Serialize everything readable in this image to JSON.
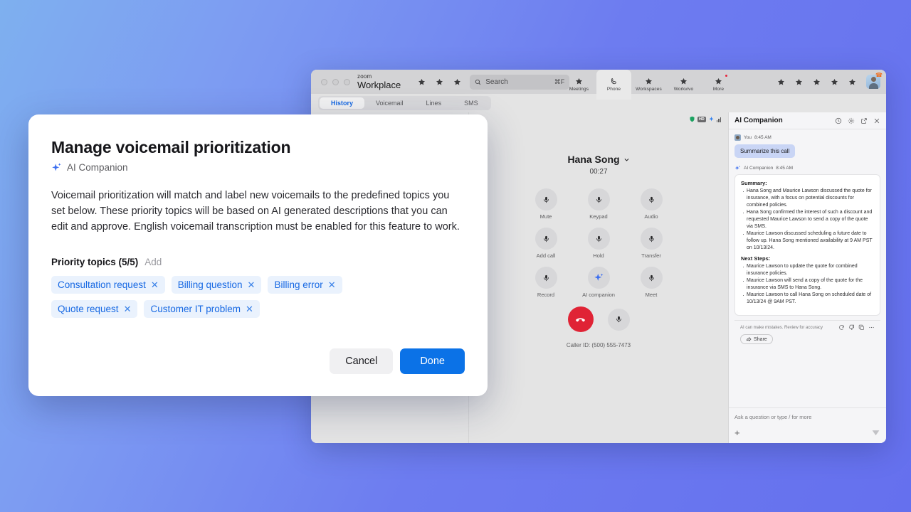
{
  "app": {
    "brand_top": "zoom",
    "brand_bottom": "Workplace",
    "search": {
      "placeholder": "Search",
      "shortcut": "⌘F"
    },
    "nav_tabs": [
      {
        "label": "Meetings",
        "icon": "star-icon",
        "active": false,
        "badge": false
      },
      {
        "label": "Phone",
        "icon": "phone-icon",
        "active": true,
        "badge": false
      },
      {
        "label": "Workspaces",
        "icon": "star-icon",
        "active": false,
        "badge": false
      },
      {
        "label": "Workvivo",
        "icon": "star-icon",
        "active": false,
        "badge": false
      },
      {
        "label": "More",
        "icon": "star-icon",
        "active": false,
        "badge": true
      }
    ],
    "sub_tabs": [
      {
        "label": "History",
        "active": true
      },
      {
        "label": "Voicemail",
        "active": false
      },
      {
        "label": "Lines",
        "active": false
      },
      {
        "label": "SMS",
        "active": false
      }
    ],
    "status_icons": [
      "shield-icon",
      "hd-badge",
      "sparkle-icon",
      "signal-bars-icon"
    ],
    "hd_label": "HD"
  },
  "call": {
    "caller_name": "Hana Song",
    "timer": "00:27",
    "caller_id": "Caller ID: (500) 555-7473",
    "controls": [
      {
        "label": "Mute",
        "icon": "microphone-icon"
      },
      {
        "label": "Keypad",
        "icon": "microphone-icon"
      },
      {
        "label": "Audio",
        "icon": "microphone-icon"
      },
      {
        "label": "Add call",
        "icon": "microphone-icon"
      },
      {
        "label": "Hold",
        "icon": "microphone-icon"
      },
      {
        "label": "Transfer",
        "icon": "microphone-icon"
      },
      {
        "label": "Record",
        "icon": "microphone-icon"
      },
      {
        "label": "AI companion",
        "icon": "sparkle-icon"
      },
      {
        "label": "Meet",
        "icon": "microphone-icon"
      }
    ]
  },
  "ai_panel": {
    "title": "AI Companion",
    "header_icons": [
      "history-icon",
      "gear-icon",
      "popout-icon",
      "close-icon"
    ],
    "user_message": {
      "author": "You",
      "time": "8:45 AM",
      "text": "Summarize this call"
    },
    "assistant_message": {
      "author": "AI Companion",
      "time": "8:45 AM",
      "summary_title": "Summary:",
      "summary_items": [
        "Hana Song and Maurice Lawson discussed the quote for insurance, with a focus on potential discounts for combined policies.",
        "Hana Song confirmed the interest of such a discount and requested Maurice Lawson to send a copy of the quote via SMS.",
        "Maurice Lawson discussed scheduling a future date to follow up. Hana Song mentioned availability at 9 AM PST on 10/13/24."
      ],
      "next_steps_title": "Next Steps:",
      "next_steps_items": [
        "Maurice Lawson to update the quote for combined insurance policies.",
        "Maurice Lawson will send a copy of the quote for the insurance via SMS to Hana Song.",
        "Maurice Lawson to call Hana Song on scheduled date of 10/13/24 @ 9AM PST."
      ]
    },
    "disclaimer": "AI can make mistakes. Review for accuracy",
    "footer_icons": [
      "regenerate-icon",
      "thumbs-down-icon",
      "copy-icon",
      "more-icon"
    ],
    "share_label": "Share",
    "input_placeholder": "Ask a question or type / for more"
  },
  "modal": {
    "title": "Manage voicemail prioritization",
    "subtitle": "AI Companion",
    "description": "Voicemail prioritization will match and label new voicemails to the predefined topics you set below. These priority topics will be based on AI generated descriptions that you can edit and approve. English voicemail transcription must be enabled for this feature to work.",
    "topics_label": "Priority topics (5/5)",
    "add_label": "Add",
    "topics": [
      "Consultation request",
      "Billing question",
      "Billing error",
      "Quote request",
      "Customer IT problem"
    ],
    "cancel_label": "Cancel",
    "done_label": "Done"
  },
  "colors": {
    "accent_blue": "#1668e3",
    "primary_button": "#0b72e7",
    "chip_bg": "#eaf2fd",
    "end_call_red": "#e02335",
    "badge_red": "#e8243c"
  }
}
